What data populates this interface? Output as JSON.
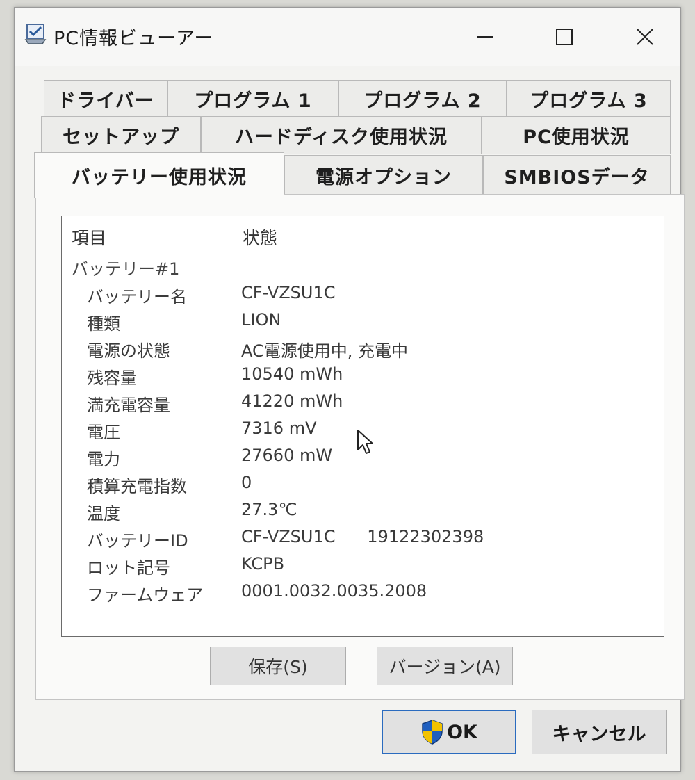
{
  "window": {
    "title": "PC情報ビューアー",
    "controls": {
      "minimize": "—",
      "maximize": "☐",
      "close": "✕"
    }
  },
  "tabs": {
    "row1": [
      "ドライバー",
      "プログラム 1",
      "プログラム 2",
      "プログラム 3"
    ],
    "row2": [
      "セットアップ",
      "ハードディスク使用状況",
      "PC使用状況"
    ],
    "row3": [
      "バッテリー使用状況",
      "電源オプション",
      "SMBIOSデータ"
    ],
    "active": "バッテリー使用状況"
  },
  "list": {
    "headers": {
      "item": "項目",
      "status": "状態"
    },
    "group": "バッテリー#1",
    "rows": [
      {
        "name": "バッテリー名",
        "value": "CF-VZSU1C"
      },
      {
        "name": "種類",
        "value": "LION"
      },
      {
        "name": "電源の状態",
        "value": "AC電源使用中, 充電中"
      },
      {
        "name": "残容量",
        "value": "10540 mWh"
      },
      {
        "name": "満充電容量",
        "value": "41220 mWh"
      },
      {
        "name": "電圧",
        "value": "7316 mV"
      },
      {
        "name": "電力",
        "value": "27660 mW"
      },
      {
        "name": "積算充電指数",
        "value": "0"
      },
      {
        "name": "温度",
        "value": "27.3℃"
      },
      {
        "name": "バッテリーID",
        "value": "CF-VZSU1C      19122302398"
      },
      {
        "name": "ロット記号",
        "value": "KCPB"
      },
      {
        "name": "ファームウェア",
        "value": "0001.0032.0035.2008"
      }
    ]
  },
  "buttons": {
    "save": "保存(S)",
    "version": "バージョン(A)",
    "ok": "OK",
    "cancel": "キャンセル"
  },
  "colors": {
    "ok_border": "#2a6bbf",
    "shield_blue": "#1f5fbf",
    "shield_yellow": "#f2c200"
  }
}
